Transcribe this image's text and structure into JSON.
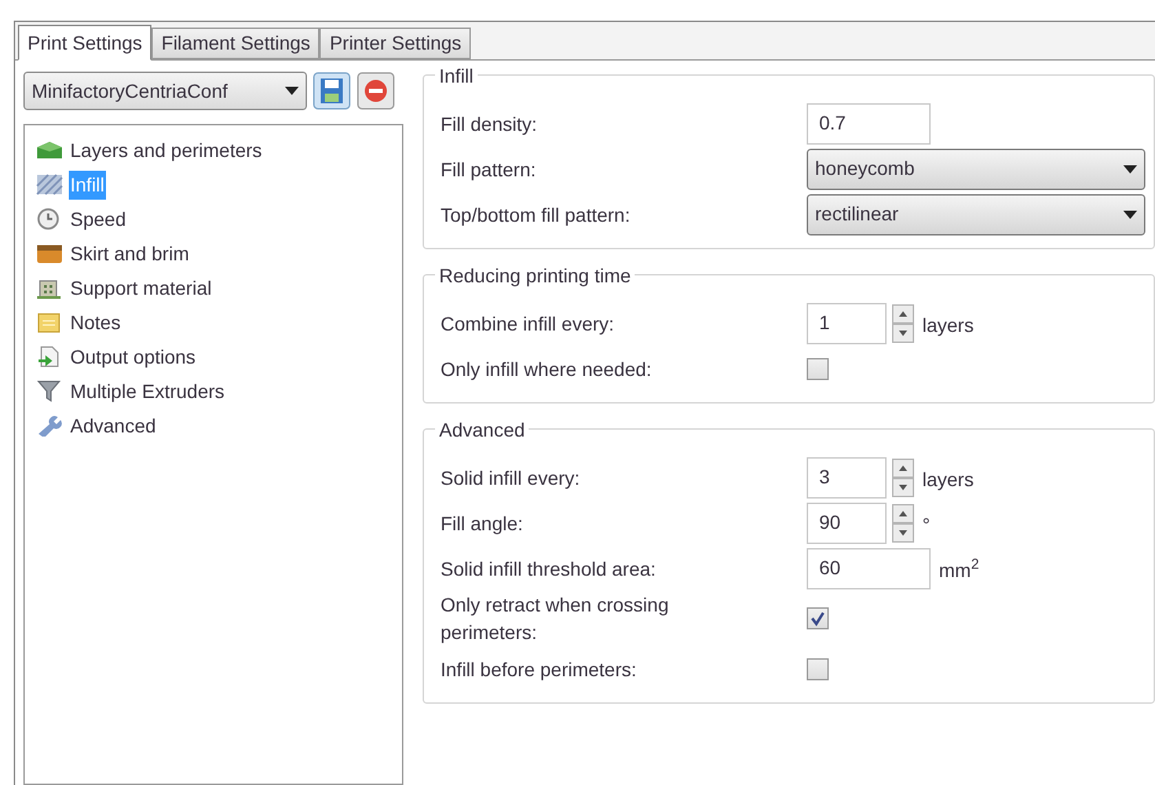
{
  "tabs": [
    {
      "label": "Print Settings",
      "selected": true
    },
    {
      "label": "Filament Settings",
      "selected": false
    },
    {
      "label": "Printer Settings",
      "selected": false
    }
  ],
  "preset": {
    "value": "MinifactoryCentriaConf"
  },
  "sidebar": {
    "items": [
      {
        "label": "Layers and perimeters",
        "selected": false
      },
      {
        "label": "Infill",
        "selected": true
      },
      {
        "label": "Speed",
        "selected": false
      },
      {
        "label": "Skirt and brim",
        "selected": false
      },
      {
        "label": "Support material",
        "selected": false
      },
      {
        "label": "Notes",
        "selected": false
      },
      {
        "label": "Output options",
        "selected": false
      },
      {
        "label": "Multiple Extruders",
        "selected": false
      },
      {
        "label": "Advanced",
        "selected": false
      }
    ]
  },
  "groups": [
    {
      "title": "Infill",
      "rows": [
        {
          "kind": "text",
          "label": "Fill density:",
          "value": "0.7"
        },
        {
          "kind": "select",
          "label": "Fill pattern:",
          "value": "honeycomb"
        },
        {
          "kind": "select",
          "label": "Top/bottom fill pattern:",
          "value": "rectilinear"
        }
      ]
    },
    {
      "title": "Reducing printing time",
      "rows": [
        {
          "kind": "spin",
          "label": "Combine infill every:",
          "value": "1",
          "unit": "layers"
        },
        {
          "kind": "checkbox",
          "label": "Only infill where needed:",
          "checked": false
        }
      ]
    },
    {
      "title": "Advanced",
      "rows": [
        {
          "kind": "spin",
          "label": "Solid infill every:",
          "value": "3",
          "unit": "layers"
        },
        {
          "kind": "spin",
          "label": "Fill angle:",
          "value": "90",
          "unit": "°"
        },
        {
          "kind": "text",
          "label": "Solid infill threshold area:",
          "value": "60",
          "unit": "mm$^{2}$"
        },
        {
          "kind": "checkbox",
          "label": "Only retract when crossing perimeters:",
          "checked": true
        },
        {
          "kind": "checkbox",
          "label": "Infill before perimeters:",
          "checked": false
        }
      ]
    }
  ]
}
